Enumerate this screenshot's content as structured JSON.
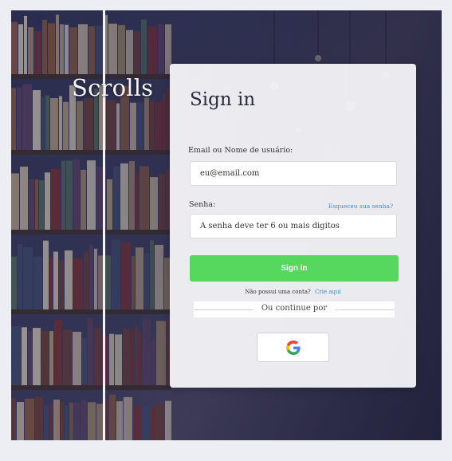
{
  "brand": {
    "name": "Scrolls"
  },
  "signin": {
    "title": "Sign in",
    "username_label": "Email ou Nome de usuário:",
    "username_placeholder": "eu@email.com",
    "password_label": "Senha:",
    "forgot_link": "Esqueceu sua senha?",
    "password_placeholder": "A senha deve ter 6 ou mais digitos",
    "submit_label": "Sign in",
    "no_account_text": "Não possui uma conta?",
    "create_link": "Crie aqui",
    "divider_text": "Ou continue por"
  },
  "social": {
    "google_icon": "google-icon"
  },
  "colors": {
    "accent_green": "#55d85d",
    "link_blue": "#3a8bd6",
    "google_blue": "#4285F4",
    "google_red": "#EA4335",
    "google_yellow": "#FBBC05",
    "google_green": "#34A853"
  }
}
